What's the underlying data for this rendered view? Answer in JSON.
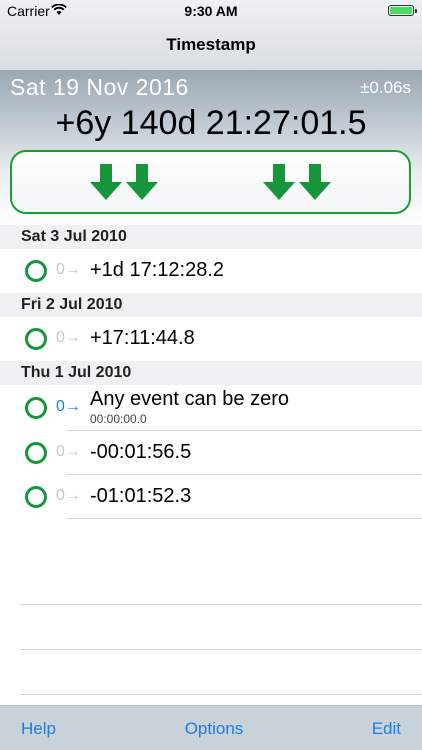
{
  "status_bar": {
    "carrier": "Carrier",
    "time": "9:30 AM"
  },
  "nav": {
    "title": "Timestamp"
  },
  "header": {
    "date": "Sat 19 Nov 2016",
    "precision": "±0.06s",
    "offset": "+6y 140d 21:27:01.5"
  },
  "colors": {
    "accent_green": "#16953a",
    "link_blue": "#1a7ee8"
  },
  "sections": [
    {
      "title": "Sat 3 Jul 2010",
      "rows": [
        {
          "zero_label": "0→",
          "value": "+1d 17:12:28.2"
        }
      ]
    },
    {
      "title": "Fri 2 Jul 2010",
      "rows": [
        {
          "zero_label": "0→",
          "value": "+17:11:44.8"
        }
      ]
    },
    {
      "title": "Thu 1 Jul 2010",
      "rows": [
        {
          "zero_label": "0→",
          "title": "Any event can be zero",
          "subtitle": "00:00:00.0",
          "active": true
        },
        {
          "zero_label": "0→",
          "value": "-00:01:56.5"
        },
        {
          "zero_label": "0→",
          "value": "-01:01:52.3"
        }
      ]
    }
  ],
  "toolbar": {
    "help": "Help",
    "options": "Options",
    "edit": "Edit"
  }
}
